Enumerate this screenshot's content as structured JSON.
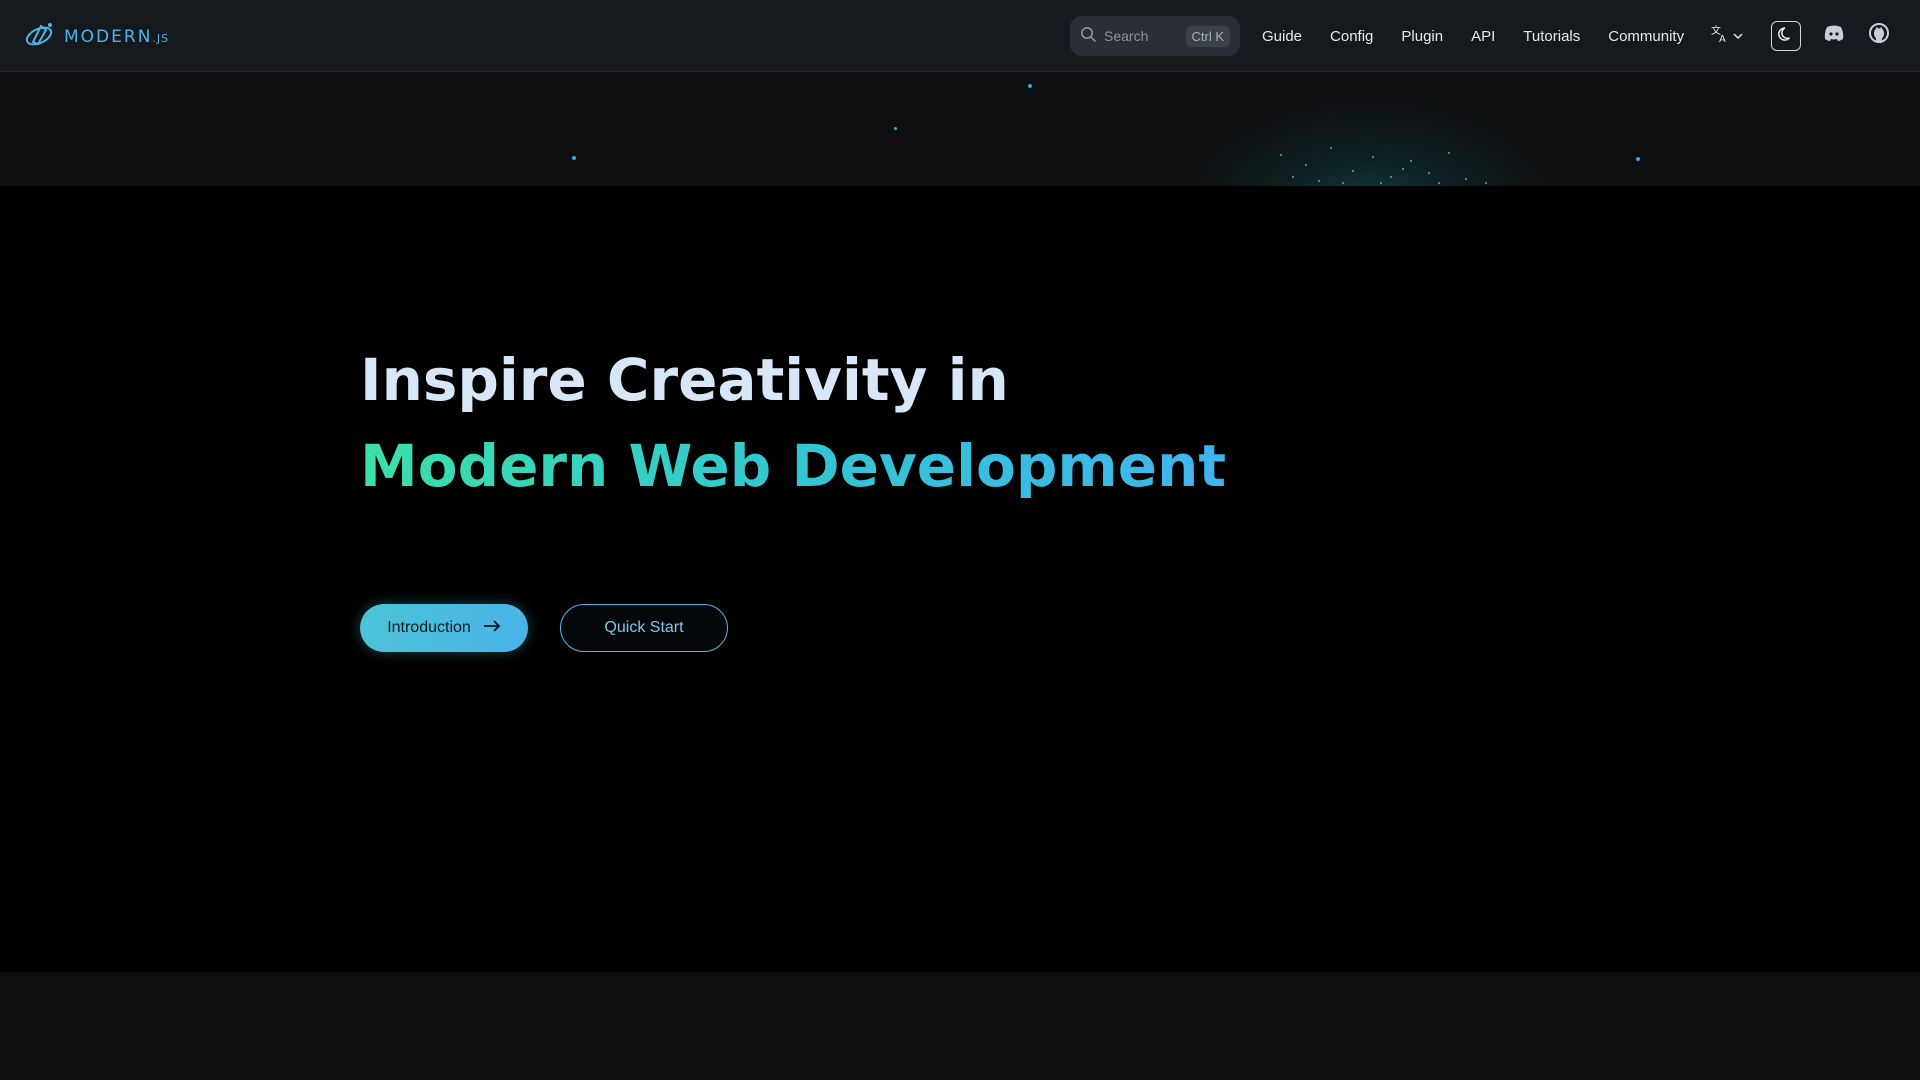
{
  "navbar": {
    "logo_text": "MODERN",
    "logo_suffix": ".JS",
    "search": {
      "placeholder": "Search",
      "shortcut": "Ctrl K"
    },
    "links": [
      {
        "label": "Guide"
      },
      {
        "label": "Config"
      },
      {
        "label": "Plugin"
      },
      {
        "label": "API"
      },
      {
        "label": "Tutorials"
      },
      {
        "label": "Community"
      }
    ],
    "icons": {
      "language": "translate-icon",
      "theme": "moon-icon",
      "discord": "discord-icon",
      "github": "github-icon"
    }
  },
  "hero": {
    "title_line1": "Inspire Creativity in",
    "title_line2": "Modern Web Development",
    "primary_button": "Introduction",
    "secondary_button": "Quick Start"
  },
  "colors": {
    "accent_start": "#3be0a8",
    "accent_end": "#40b4ef",
    "background": "#000000",
    "navbar": "#161a1f"
  }
}
